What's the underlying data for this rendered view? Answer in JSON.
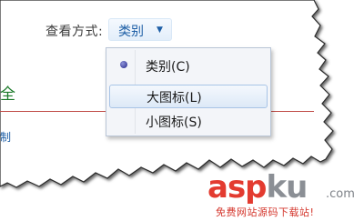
{
  "view_options": {
    "label": "查看方式:",
    "selected": "类别",
    "dropdown_arrow": "▼"
  },
  "background": {
    "heading_fragment": "全",
    "link_fragment": "制"
  },
  "menu": {
    "items": [
      {
        "label": "类别(C)",
        "selected": true
      },
      {
        "label": "大图标(L)",
        "hovered": true
      },
      {
        "label": "小图标(S)"
      }
    ]
  },
  "watermark": {
    "part1": "asp",
    "part2": "ku",
    "tld": ".com",
    "tagline": "免费网站源码下载站!"
  }
}
